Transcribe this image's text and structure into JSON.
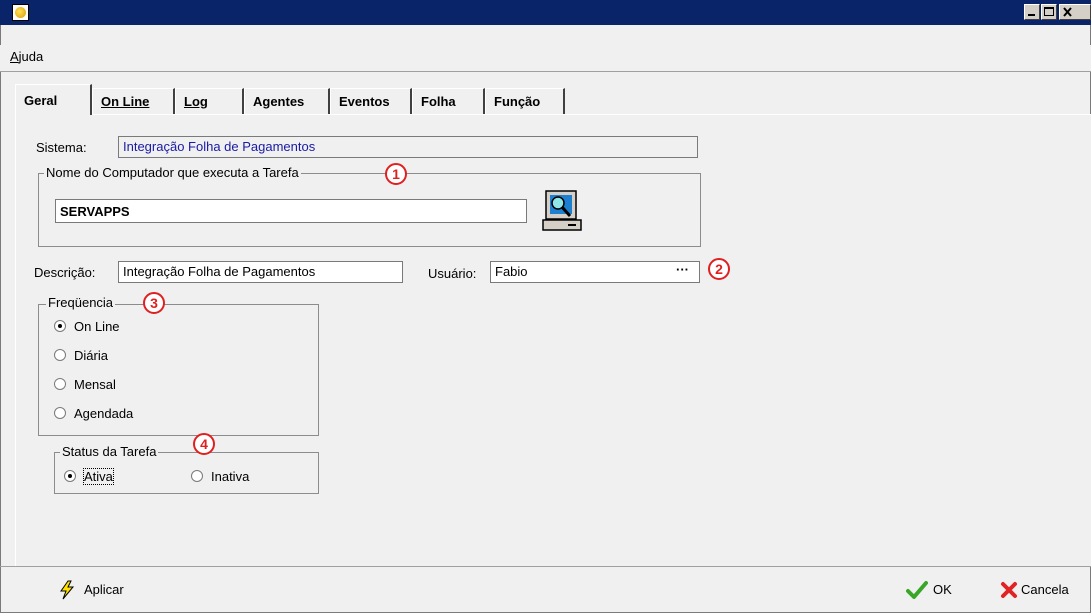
{
  "menu": {
    "ajuda_label": "Ajuda"
  },
  "tabs": [
    {
      "label": "Geral"
    },
    {
      "label": "On Line"
    },
    {
      "label": "Log"
    },
    {
      "label": "Agentes"
    },
    {
      "label": "Eventos"
    },
    {
      "label": "Folha"
    },
    {
      "label": "Função"
    }
  ],
  "sistema": {
    "label": "Sistema:",
    "value": "Integração Folha de Pagamentos"
  },
  "computador": {
    "legend": "Nome do Computador que executa a Tarefa",
    "value": "SERVAPPS",
    "callout": "1"
  },
  "descricao": {
    "label": "Descrição:",
    "value": "Integração Folha de Pagamentos"
  },
  "usuario": {
    "label": "Usuário:",
    "value": "Fabio",
    "ellipsis": "···",
    "callout": "2"
  },
  "frequencia": {
    "legend": "Freqüencia",
    "callout": "3",
    "options": [
      "On Line",
      "Diária",
      "Mensal",
      "Agendada"
    ],
    "selected": "On Line"
  },
  "status": {
    "legend": "Status da Tarefa",
    "callout": "4",
    "ativa": "Ativa",
    "inativa": "Inativa",
    "selected": "Ativa"
  },
  "footer": {
    "aplicar": "Aplicar",
    "ok": "OK",
    "cancela": "Cancela"
  },
  "icons": {
    "app": "app-icon",
    "computer": "computer-search-icon",
    "aplicar": "lightning-icon",
    "ok": "checkmark-icon",
    "cancela": "x-icon"
  },
  "colors": {
    "titlebar": "#0a246a",
    "callout": "#e02020",
    "readonly_text": "#1a1aa6"
  }
}
